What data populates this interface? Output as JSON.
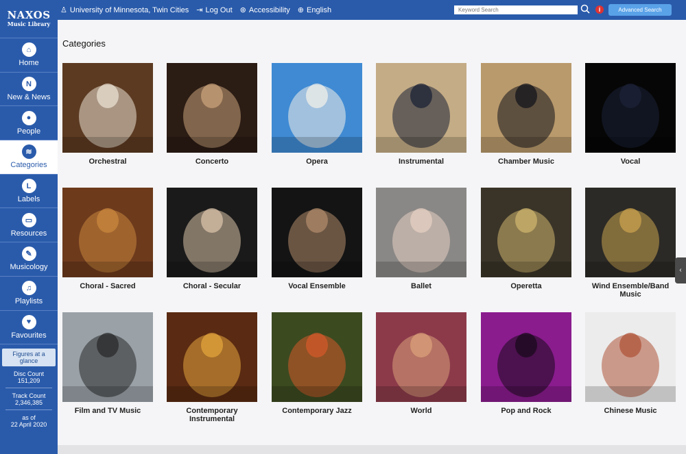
{
  "logo": {
    "main": "NAXOS",
    "sub": "Music Library"
  },
  "nav": [
    {
      "label": "Home",
      "icon": "home-icon",
      "glyph": "⌂",
      "active": false
    },
    {
      "label": "New & News",
      "icon": "new-icon",
      "glyph": "N",
      "active": false
    },
    {
      "label": "People",
      "icon": "person-icon",
      "glyph": "●",
      "active": false
    },
    {
      "label": "Categories",
      "icon": "layers-icon",
      "glyph": "≋",
      "active": true
    },
    {
      "label": "Labels",
      "icon": "labels-icon",
      "glyph": "L",
      "active": false
    },
    {
      "label": "Resources",
      "icon": "folder-icon",
      "glyph": "▭",
      "active": false
    },
    {
      "label": "Musicology",
      "icon": "notebook-icon",
      "glyph": "✎",
      "active": false
    },
    {
      "label": "Playlists",
      "icon": "playlist-icon",
      "glyph": "♫",
      "active": false
    },
    {
      "label": "Favourites",
      "icon": "heart-icon",
      "glyph": "♥",
      "active": false
    }
  ],
  "glance": {
    "title": "Figures at a glance",
    "disc_label": "Disc Count",
    "disc_value": "151,209",
    "track_label": "Track Count",
    "track_value": "2,346,385",
    "asof_label": "as of",
    "asof_value": "22 April 2020"
  },
  "topbar": {
    "institution": "University of Minnesota, Twin Cities",
    "logout": "Log Out",
    "accessibility": "Accessibility",
    "language": "English",
    "search_placeholder": "Keyword Search",
    "advanced": "Advanced Search"
  },
  "page_title": "Categories",
  "categories": [
    {
      "name": "Orchestral",
      "bg": "#5c3a22",
      "fg": "#e9e0d2"
    },
    {
      "name": "Concerto",
      "bg": "#2b1c14",
      "fg": "#c9a27a"
    },
    {
      "name": "Opera",
      "bg": "#3f8ad3",
      "fg": "#f2efe8"
    },
    {
      "name": "Instrumental",
      "bg": "#c4ac86",
      "fg": "#1b2236"
    },
    {
      "name": "Chamber Music",
      "bg": "#b99a6c",
      "fg": "#14141c"
    },
    {
      "name": "Vocal",
      "bg": "#060606",
      "fg": "#1c2238"
    },
    {
      "name": "Choral - Sacred",
      "bg": "#6d3a1c",
      "fg": "#c9873e"
    },
    {
      "name": "Choral - Secular",
      "bg": "#1a1a1a",
      "fg": "#d8c2a8"
    },
    {
      "name": "Vocal Ensemble",
      "bg": "#141414",
      "fg": "#b08a6a"
    },
    {
      "name": "Ballet",
      "bg": "#8a8886",
      "fg": "#e6cfc2"
    },
    {
      "name": "Operetta",
      "bg": "#3a3428",
      "fg": "#cdb46e"
    },
    {
      "name": "Wind Ensemble/Band Music",
      "bg": "#2c2a26",
      "fg": "#c9a24e"
    },
    {
      "name": "Film and TV Music",
      "bg": "#9aa2a8",
      "fg": "#2a2a2a"
    },
    {
      "name": "Contemporary Instrumental",
      "bg": "#5a2a12",
      "fg": "#e3a43c"
    },
    {
      "name": "Contemporary Jazz",
      "bg": "#3c4a20",
      "fg": "#d25a2a"
    },
    {
      "name": "World",
      "bg": "#8c3a4a",
      "fg": "#d9a07a"
    },
    {
      "name": "Pop and Rock",
      "bg": "#8a1c8e",
      "fg": "#1a0a1c"
    },
    {
      "name": "Chinese Music",
      "bg": "#ececec",
      "fg": "#b0553a"
    }
  ],
  "side_tab": "‹"
}
